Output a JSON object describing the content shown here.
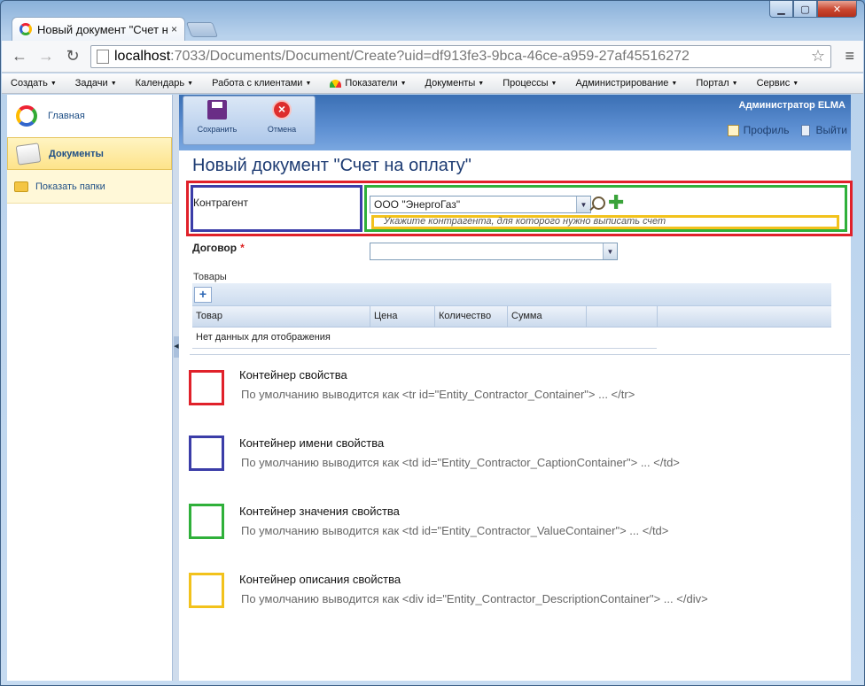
{
  "browser": {
    "tab_title": "Новый документ \"Счет на",
    "tab_close": "×",
    "url_host": "localhost",
    "url_path": ":7033/Documents/Document/Create?uid=df913fe3-9bca-46ce-a959-27af45516272",
    "window_min": "▁",
    "window_max": "▢",
    "window_close": "✕"
  },
  "menu": [
    {
      "label": "Создать",
      "arrow": "▼"
    },
    {
      "label": "Задачи",
      "arrow": "▼"
    },
    {
      "label": "Календарь",
      "arrow": "▼"
    },
    {
      "label": "Работа с клиентами",
      "arrow": "▼"
    },
    {
      "label": "Показатели",
      "arrow": "▼"
    },
    {
      "label": "Документы",
      "arrow": "▼"
    },
    {
      "label": "Процессы",
      "arrow": "▼"
    },
    {
      "label": "Администрирование",
      "arrow": "▼"
    },
    {
      "label": "Портал",
      "arrow": "▼"
    },
    {
      "label": "Сервис",
      "arrow": "▼"
    }
  ],
  "sidebar": {
    "main": "Главная",
    "documents": "Документы",
    "show_folders": "Показать папки"
  },
  "toolbar": {
    "save": "Сохранить",
    "cancel": "Отмена",
    "user": "Администратор ELMA",
    "profile": "Профиль",
    "logout": "Выйти"
  },
  "form": {
    "title": "Новый документ \"Счет на оплату\"",
    "contractor_label": "Контрагент",
    "contractor_value": "ООО \"ЭнергоГаз\"",
    "contractor_hint": "Укажите контрагента, для которого нужно выписать счет",
    "contract_label": "Договор",
    "required_mark": "*",
    "goods_label": "Товары",
    "add_glyph": "+",
    "columns": [
      "Товар",
      "Цена",
      "Количество",
      "Сумма"
    ],
    "empty_text": "Нет данных для отображения"
  },
  "legend": [
    {
      "title": "Контейнер свойства",
      "desc": "По умолчанию выводится как <tr id=\"Entity_Contractor_Container\"> ... </tr>",
      "color": "#e0212a"
    },
    {
      "title": "Контейнер имени свойства",
      "desc": "По умолчанию выводится как <td id=\"Entity_Contractor_CaptionContainer\"> ... </td>",
      "color": "#3b3da8"
    },
    {
      "title": "Контейнер значения свойства",
      "desc": "По умолчанию выводится как <td id=\"Entity_Contractor_ValueContainer\"> ... </td>",
      "color": "#2fb03a"
    },
    {
      "title": "Контейнер описания свойства",
      "desc": "По умолчанию выводится как <div id=\"Entity_Contractor_DescriptionContainer\"> ... </div>",
      "color": "#f2c21c"
    }
  ]
}
